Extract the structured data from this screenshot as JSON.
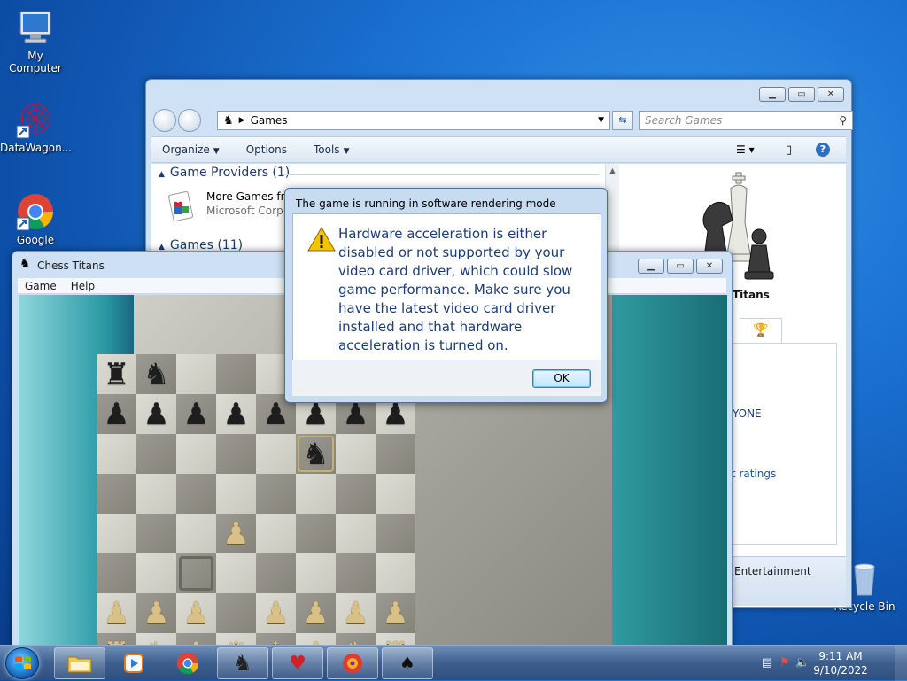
{
  "desktop": {
    "icons": [
      {
        "label": "My Computer"
      },
      {
        "label": "DataWagon..."
      },
      {
        "label": "Google"
      },
      {
        "label": "Recycle Bin"
      }
    ]
  },
  "explorer": {
    "breadcrumb": "Games",
    "search_placeholder": "Search Games",
    "toolbar": {
      "organize": "Organize",
      "options": "Options",
      "tools": "Tools"
    },
    "groups": [
      {
        "label": "Game Providers (1)"
      },
      {
        "label": "Games (11)"
      }
    ],
    "provider": {
      "name": "More Games fr",
      "company": "Microsoft Corp"
    },
    "details": {
      "game_name": "Titans",
      "rating": "EVERYONE",
      "rating_link": "about ratings",
      "category": "Entertainment"
    }
  },
  "chess": {
    "title": "Chess Titans",
    "menu": [
      "Game",
      "Help"
    ],
    "board": [
      [
        "r",
        "n",
        "",
        "",
        "",
        "",
        "",
        ""
      ],
      [
        "p",
        "p",
        "p",
        "p",
        "p",
        "p",
        "p",
        "p"
      ],
      [
        "",
        "",
        "",
        "",
        "",
        "n",
        "",
        ""
      ],
      [
        "",
        "",
        "",
        "",
        "",
        "",
        "",
        ""
      ],
      [
        "",
        "",
        "",
        "P",
        "",
        "",
        "",
        ""
      ],
      [
        "",
        "",
        "",
        "",
        "",
        "",
        "",
        ""
      ],
      [
        "P",
        "P",
        "P",
        "",
        "P",
        "P",
        "P",
        "P"
      ],
      [
        "R",
        "N",
        "B",
        "Q",
        "K",
        "B",
        "N",
        "R"
      ]
    ]
  },
  "dialog": {
    "title": "The game is running in software rendering mode",
    "message": "Hardware acceleration is either disabled or not supported by your video card driver, which could slow game performance. Make sure you have the latest video card driver installed and that hardware acceleration is turned on.",
    "ok_label": "OK"
  },
  "taskbar": {
    "time": "9:11 AM",
    "date": "9/10/2022"
  },
  "colors": {
    "desktop_blue": "#1a6fcf",
    "dialog_text": "#1c3c79",
    "accent": "#3c7fb1"
  }
}
